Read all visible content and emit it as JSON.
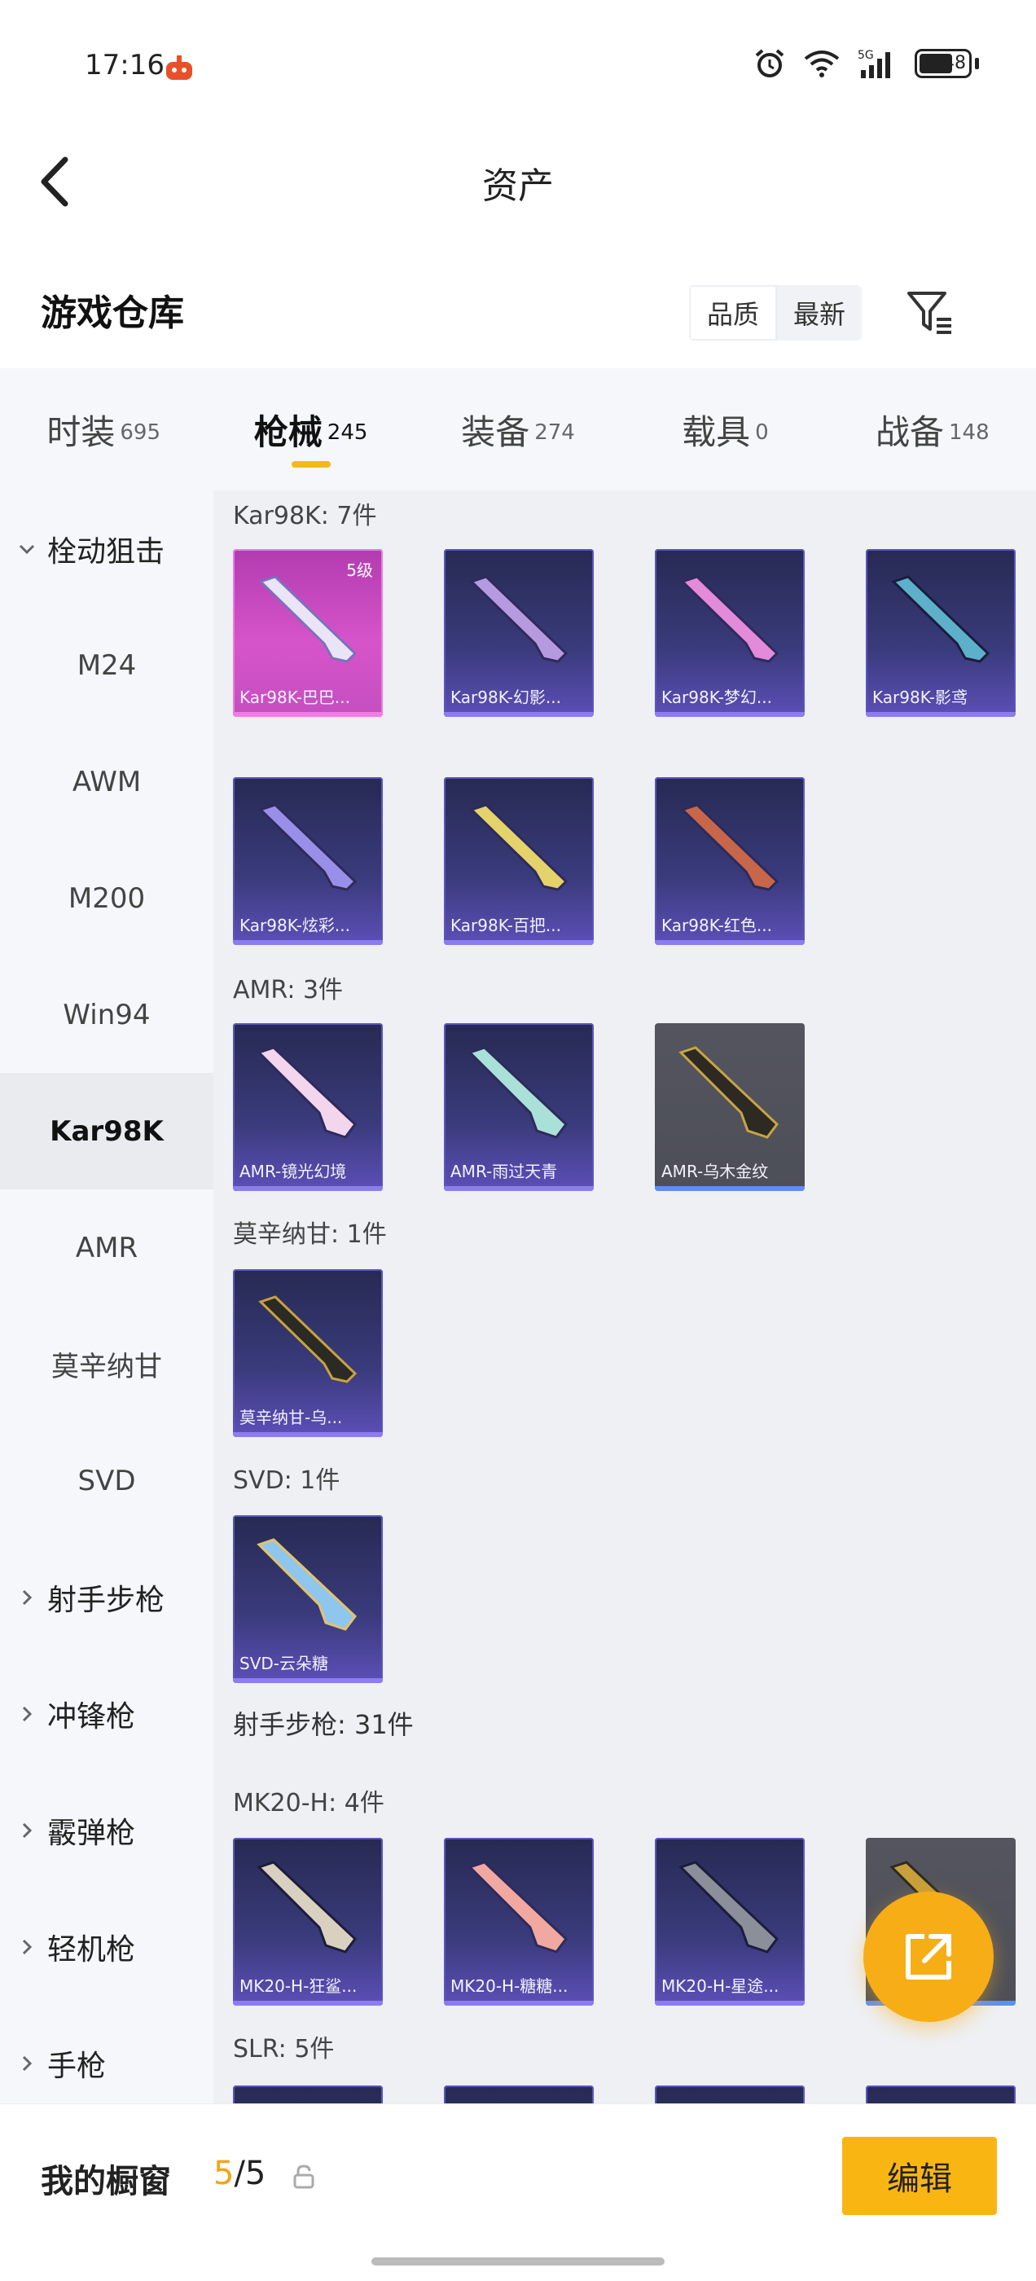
{
  "status_bar": {
    "time": "17:16",
    "network": "5G",
    "battery": "48"
  },
  "header": {
    "title": "资产"
  },
  "section": {
    "title": "游戏仓库",
    "sort_quality": "品质",
    "sort_newest": "最新"
  },
  "tabs": [
    {
      "label": "时装",
      "count": "695"
    },
    {
      "label": "枪械",
      "count": "245"
    },
    {
      "label": "装备",
      "count": "274"
    },
    {
      "label": "载具",
      "count": "0"
    },
    {
      "label": "战备",
      "count": "148"
    }
  ],
  "sidebar": {
    "group_bolt": "栓动狙击",
    "m24": "M24",
    "awm": "AWM",
    "m200": "M200",
    "win94": "Win94",
    "kar98k": "Kar98K",
    "amr": "AMR",
    "mosin": "莫辛纳甘",
    "svd": "SVD",
    "group_dmr": "射手步枪",
    "group_smg": "冲锋枪",
    "group_shotgun": "霰弹枪",
    "group_lmg": "轻机枪",
    "group_pistol": "手枪"
  },
  "content": {
    "kar98k_label": "Kar98K: 7件",
    "kar98k_items": [
      "Kar98K-巴巴...",
      "Kar98K-幻影...",
      "Kar98K-梦幻...",
      "Kar98K-影鸢",
      "Kar98K-炫彩...",
      "Kar98K-百把...",
      "Kar98K-红色..."
    ],
    "kar98k_level": "5级",
    "amr_label": "AMR: 3件",
    "amr_items": [
      "AMR-镜光幻境",
      "AMR-雨过天青",
      "AMR-乌木金纹"
    ],
    "mosin_label": "莫辛纳甘: 1件",
    "mosin_items": [
      "莫辛纳甘-乌..."
    ],
    "svd_label": "SVD: 1件",
    "svd_items": [
      "SVD-云朵糖"
    ],
    "dmr_label": "射手步枪: 31件",
    "mk20_label": "MK20-H: 4件",
    "mk20_items": [
      "MK20-H-狂鲨...",
      "MK20-H-糖糖...",
      "MK20-H-星途...",
      ""
    ],
    "slr_label": "SLR: 5件"
  },
  "bottom": {
    "showcase_label": "我的橱窗",
    "showcase_current": "5",
    "showcase_total": "/5",
    "edit_label": "编辑"
  },
  "colors": {
    "accent": "#f5b917",
    "fab": "#f7ad16",
    "card_purple": "#3a3b7c",
    "card_pink": "#c54fc0"
  }
}
